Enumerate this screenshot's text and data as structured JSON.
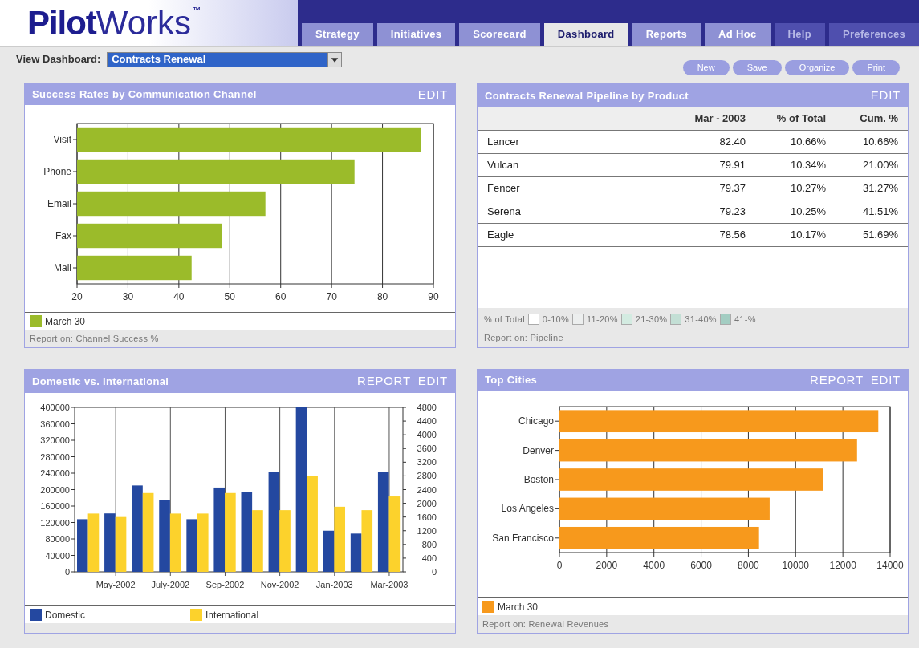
{
  "logo": {
    "bold": "Pilot",
    "light": "Works",
    "mark": "™"
  },
  "tabs": [
    {
      "label": "Strategy",
      "selected": false,
      "disabled": false
    },
    {
      "label": "Initiatives",
      "selected": false,
      "disabled": false
    },
    {
      "label": "Scorecard",
      "selected": false,
      "disabled": false
    },
    {
      "label": "Dashboard",
      "selected": true,
      "disabled": false
    },
    {
      "label": "Reports",
      "selected": false,
      "disabled": false
    },
    {
      "label": "Ad Hoc",
      "selected": false,
      "disabled": false
    },
    {
      "label": "Help",
      "selected": false,
      "disabled": true
    },
    {
      "label": "Preferences",
      "selected": false,
      "disabled": true
    }
  ],
  "toolbar": {
    "label": "View Dashboard:",
    "select_value": "Contracts Renewal",
    "buttons": [
      "New",
      "Save",
      "Organize",
      "Print"
    ]
  },
  "panels": [
    {
      "kind": "chart",
      "title": "Success Rates by Communication Channel",
      "actions": [
        "EDIT"
      ],
      "footer": "Report on: Channel Success %",
      "chart_data": {
        "type": "bar",
        "orientation": "horizontal",
        "grid": true,
        "categories": [
          "Visit",
          "Phone",
          "Email",
          "Fax",
          "Mail"
        ],
        "series": [
          {
            "name": "March 30",
            "color": "#9bbb2a",
            "values": [
              87.5,
              74.5,
              57,
              48.5,
              42.5
            ]
          }
        ],
        "xlim": [
          20,
          90
        ],
        "xticks": [
          20,
          30,
          40,
          50,
          60,
          70,
          80,
          90
        ]
      }
    },
    {
      "kind": "table",
      "title": "Contracts Renewal Pipeline by Product",
      "actions": [
        "EDIT"
      ],
      "columns": [
        "Mar - 2003",
        "% of Total",
        "Cum. %"
      ],
      "rows": [
        {
          "name": "Lancer",
          "cells": [
            "82.40",
            "10.66%",
            "10.66%"
          ]
        },
        {
          "name": "Vulcan",
          "cells": [
            "79.91",
            "10.34%",
            "21.00%"
          ]
        },
        {
          "name": "Fencer",
          "cells": [
            "79.37",
            "10.27%",
            "31.27%"
          ]
        },
        {
          "name": "Serena",
          "cells": [
            "79.23",
            "10.25%",
            "41.51%"
          ]
        },
        {
          "name": "Eagle",
          "cells": [
            "78.56",
            "10.17%",
            "51.69%"
          ]
        }
      ],
      "scale_label": "% of Total",
      "scale": [
        {
          "label": "0-10%",
          "color": "#ffffff"
        },
        {
          "label": "11-20%",
          "color": "#eceeee"
        },
        {
          "label": "21-30%",
          "color": "#d3ebe1"
        },
        {
          "label": "31-40%",
          "color": "#c3dfd5"
        },
        {
          "label": "41-%",
          "color": "#a3cdc2"
        }
      ],
      "footer": "Report on: Pipeline"
    },
    {
      "kind": "chart",
      "title": "Domestic vs. International",
      "actions": [
        "REPORT",
        "EDIT"
      ],
      "chart_data": {
        "type": "bar",
        "orientation": "vertical",
        "grid": true,
        "categories": [
          null,
          "May-2002",
          null,
          "July-2002",
          null,
          "Sep-2002",
          null,
          "Nov-2002",
          null,
          "Jan-2003",
          null,
          "Mar-2003"
        ],
        "series": [
          {
            "name": "Domestic",
            "color": "#2448a0",
            "values": [
              128000,
              142000,
              210000,
              175000,
              128000,
              205000,
              195000,
              242000,
              400000,
              100000,
              93000,
              242000
            ]
          },
          {
            "name": "International",
            "color": "#fcd22c",
            "axis": "y2",
            "values": [
              1700,
              1600,
              2300,
              1700,
              1700,
              2300,
              1800,
              1800,
              2800,
              1900,
              1800,
              2200
            ]
          }
        ],
        "ylim": [
          0,
          400000
        ],
        "yticks": [
          0,
          40000,
          80000,
          120000,
          160000,
          200000,
          240000,
          280000,
          320000,
          360000,
          400000
        ],
        "y2lim": [
          0,
          4800
        ],
        "y2ticks": [
          0,
          400,
          800,
          1200,
          1600,
          2000,
          2400,
          2800,
          3200,
          3600,
          4000,
          4400,
          4800
        ]
      }
    },
    {
      "kind": "chart",
      "title": "Top Cities",
      "actions": [
        "REPORT",
        "EDIT"
      ],
      "footer": "Report on: Renewal Revenues",
      "chart_data": {
        "type": "bar",
        "orientation": "horizontal",
        "grid": true,
        "categories": [
          "Chicago",
          "Denver",
          "Boston",
          "Los Angeles",
          "San Francisco"
        ],
        "series": [
          {
            "name": "March 30",
            "color": "#f7991c",
            "values": [
              13500,
              12600,
              11150,
              8900,
              8450
            ]
          }
        ],
        "xlim": [
          0,
          14000
        ],
        "xticks": [
          0,
          2000,
          4000,
          6000,
          8000,
          10000,
          12000,
          14000
        ]
      }
    }
  ]
}
